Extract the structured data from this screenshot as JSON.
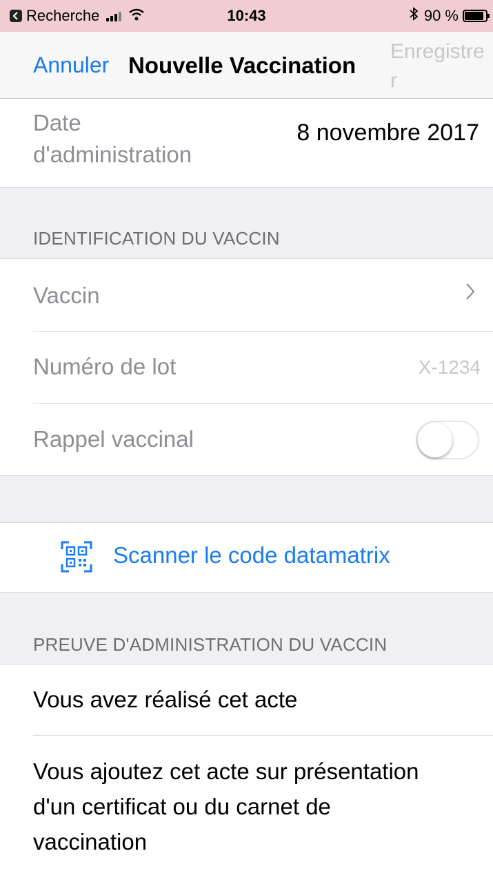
{
  "status_bar": {
    "back_app": "Recherche",
    "time": "10:43",
    "bluetooth_icon": "bluetooth-icon",
    "battery_label": "90 %",
    "battery_level": 0.9
  },
  "nav": {
    "cancel": "Annuler",
    "title": "Nouvelle Vaccination",
    "save": "Enregistrer"
  },
  "date_row": {
    "label": "Date d'administration",
    "value": "8 novembre 2017"
  },
  "vaccine_section": {
    "header": "IDENTIFICATION DU VACCIN",
    "vaccine_label": "Vaccin",
    "lot_label": "Numéro de lot",
    "lot_placeholder": "X-1234",
    "booster_label": "Rappel vaccinal",
    "booster_on": false
  },
  "scan": {
    "label": "Scanner le code datamatrix",
    "icon": "qr-scan-icon"
  },
  "proof_section": {
    "header": "PREUVE D'ADMINISTRATION DU VACCIN",
    "option1": "Vous avez réalisé cet acte",
    "option2": "Vous ajoutez cet acte sur présentation d'un certificat ou du carnet de vaccination"
  },
  "colors": {
    "accent": "#1a7cf0",
    "status_bar": "#f0cdd3",
    "background": "#efeff4"
  }
}
